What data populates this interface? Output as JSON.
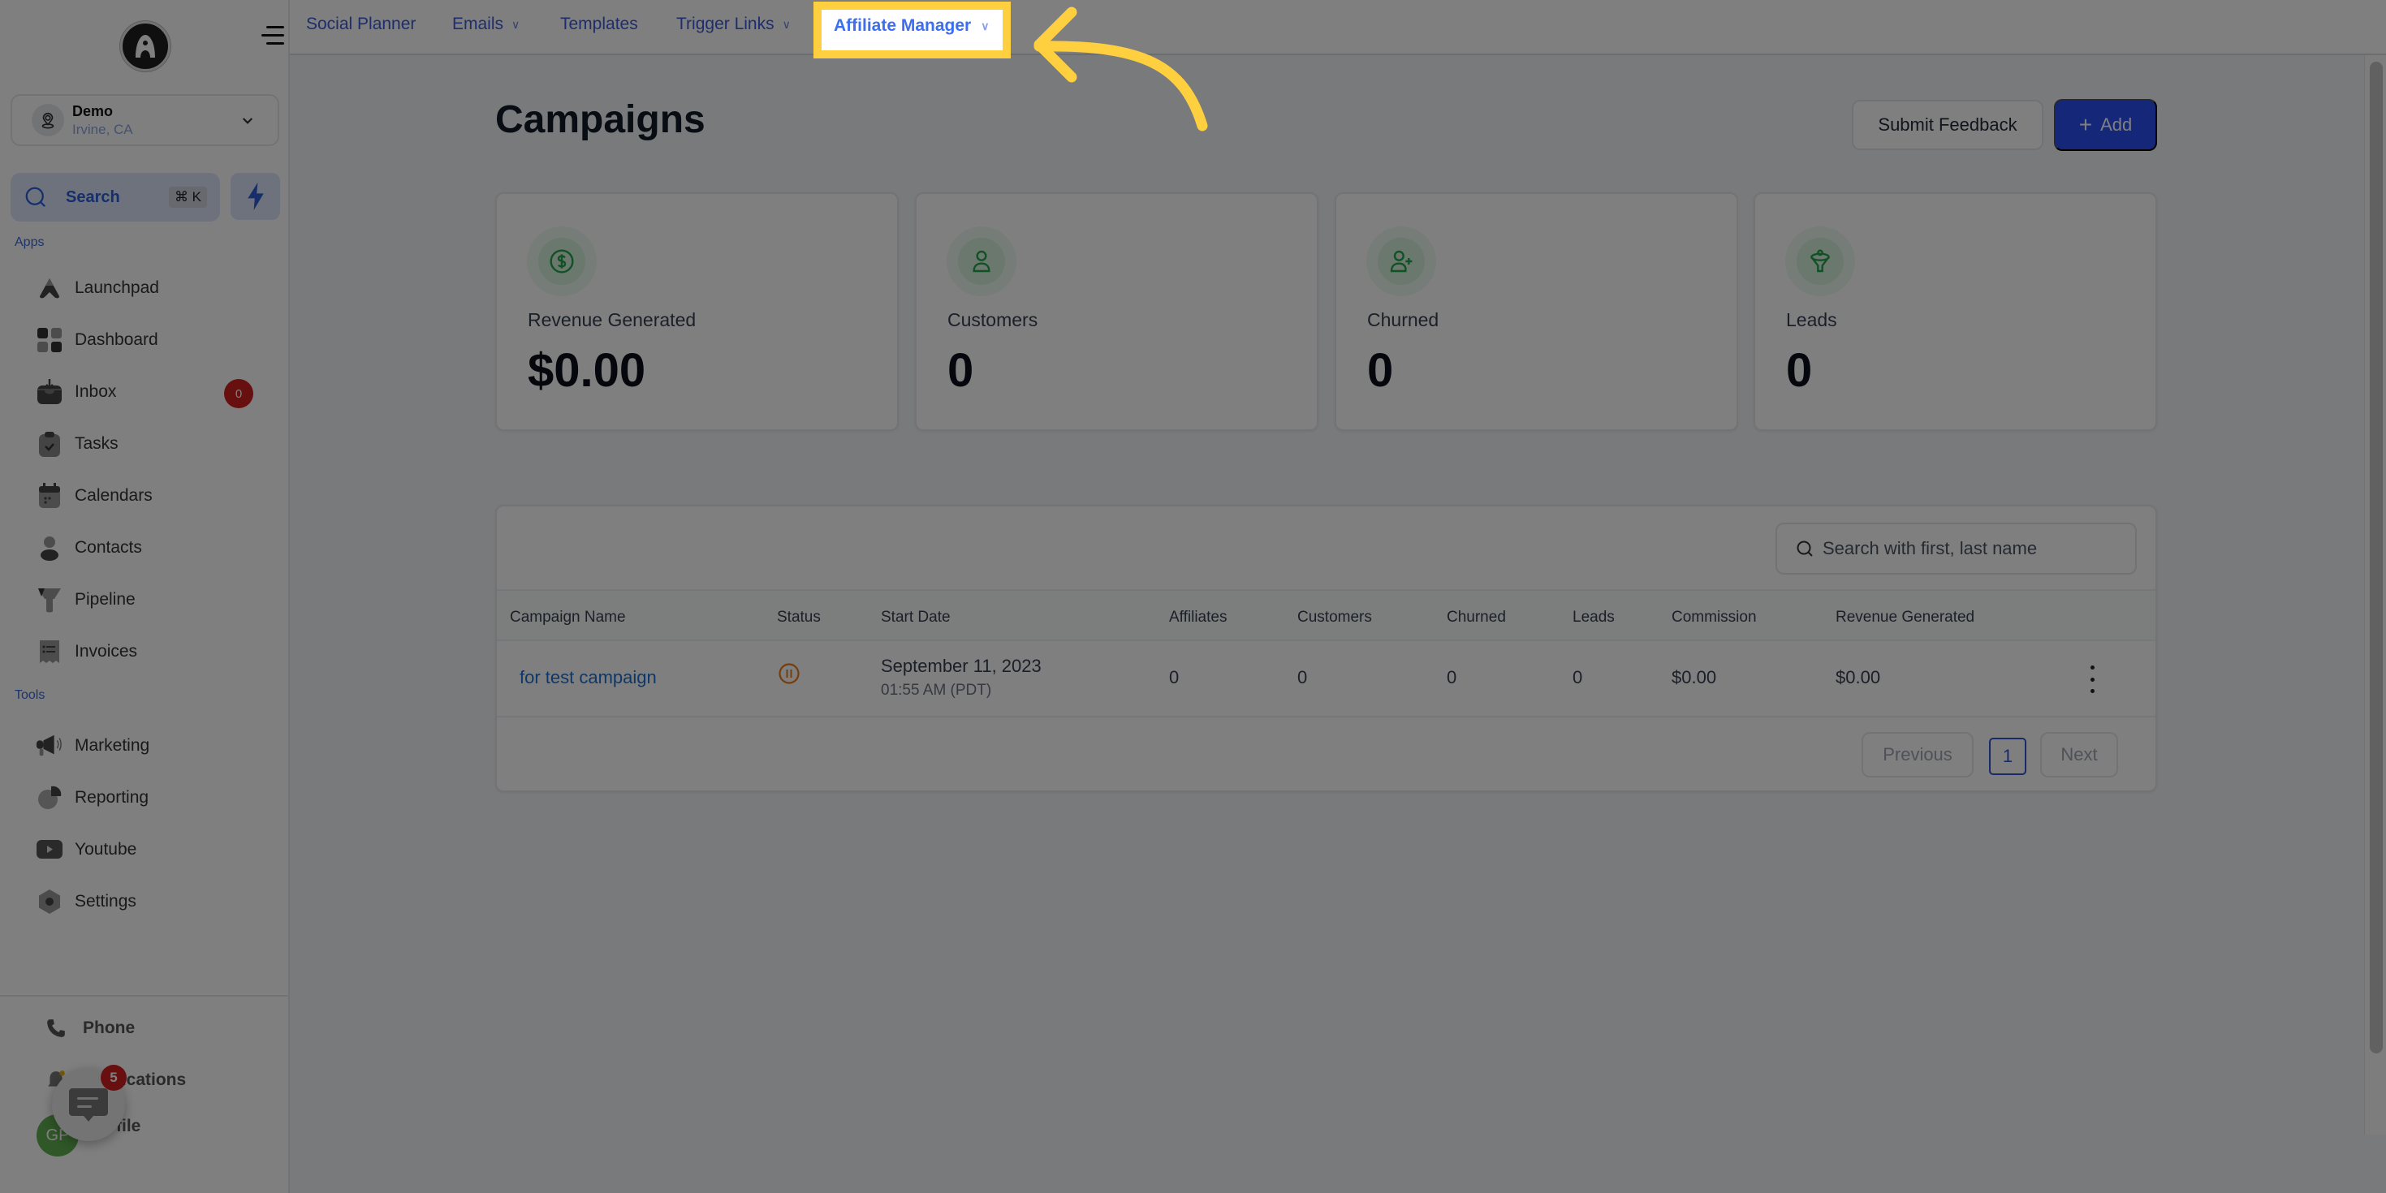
{
  "sidebar": {
    "account": {
      "name": "Demo",
      "location": "Irvine, CA"
    },
    "search": {
      "label": "Search",
      "shortcut": "⌘ K"
    },
    "sections": {
      "apps": "Apps",
      "tools": "Tools"
    },
    "apps": [
      {
        "label": "Launchpad",
        "icon": "rocket-icon"
      },
      {
        "label": "Dashboard",
        "icon": "grid-icon"
      },
      {
        "label": "Inbox",
        "icon": "inbox-icon",
        "badge": "0"
      },
      {
        "label": "Tasks",
        "icon": "clipboard-check-icon"
      },
      {
        "label": "Calendars",
        "icon": "calendar-icon"
      },
      {
        "label": "Contacts",
        "icon": "user-icon"
      },
      {
        "label": "Pipeline",
        "icon": "funnel-icon"
      },
      {
        "label": "Invoices",
        "icon": "receipt-icon"
      }
    ],
    "tools": [
      {
        "label": "Marketing",
        "icon": "megaphone-icon"
      },
      {
        "label": "Reporting",
        "icon": "pie-chart-icon"
      },
      {
        "label": "Youtube",
        "icon": "youtube-icon"
      },
      {
        "label": "Settings",
        "icon": "gear-icon"
      }
    ],
    "bottom": [
      {
        "label": "Phone",
        "icon": "phone-icon"
      },
      {
        "label": "Notifications",
        "icon": "bell-icon"
      },
      {
        "label": "Profile",
        "icon": "avatar"
      }
    ],
    "avatar_initials": "GP",
    "chat_badge": "5"
  },
  "topnav": {
    "tabs": [
      {
        "label": "Social Planner",
        "dropdown": false
      },
      {
        "label": "Emails",
        "dropdown": true
      },
      {
        "label": "Templates",
        "dropdown": false
      },
      {
        "label": "Trigger Links",
        "dropdown": true
      },
      {
        "label": "Affiliate Manager",
        "dropdown": true,
        "active": true
      }
    ]
  },
  "main": {
    "title": "Campaigns",
    "buttons": {
      "feedback": "Submit Feedback",
      "add": "Add"
    },
    "stats": [
      {
        "label": "Revenue Generated",
        "value": "$0.00",
        "icon": "dollar-icon"
      },
      {
        "label": "Customers",
        "value": "0",
        "icon": "user-icon"
      },
      {
        "label": "Churned",
        "value": "0",
        "icon": "user-plus-icon"
      },
      {
        "label": "Leads",
        "value": "0",
        "icon": "funnel-icon"
      }
    ],
    "table": {
      "search_placeholder": "Search with first, last name",
      "columns": [
        "Campaign Name",
        "Status",
        "Start Date",
        "Affiliates",
        "Customers",
        "Churned",
        "Leads",
        "Commission",
        "Revenue Generated"
      ],
      "rows": [
        {
          "name": "for test campaign",
          "status": "paused",
          "start_date": "September 11, 2023",
          "start_time": "01:55 AM (PDT)",
          "affiliates": "0",
          "customers": "0",
          "churned": "0",
          "leads": "0",
          "commission": "$0.00",
          "revenue": "$0.00"
        }
      ],
      "pagination": {
        "previous": "Previous",
        "page": "1",
        "next": "Next"
      }
    }
  },
  "annotation": {
    "highlight_color": "#fecf3e",
    "target": "Affiliate Manager"
  }
}
